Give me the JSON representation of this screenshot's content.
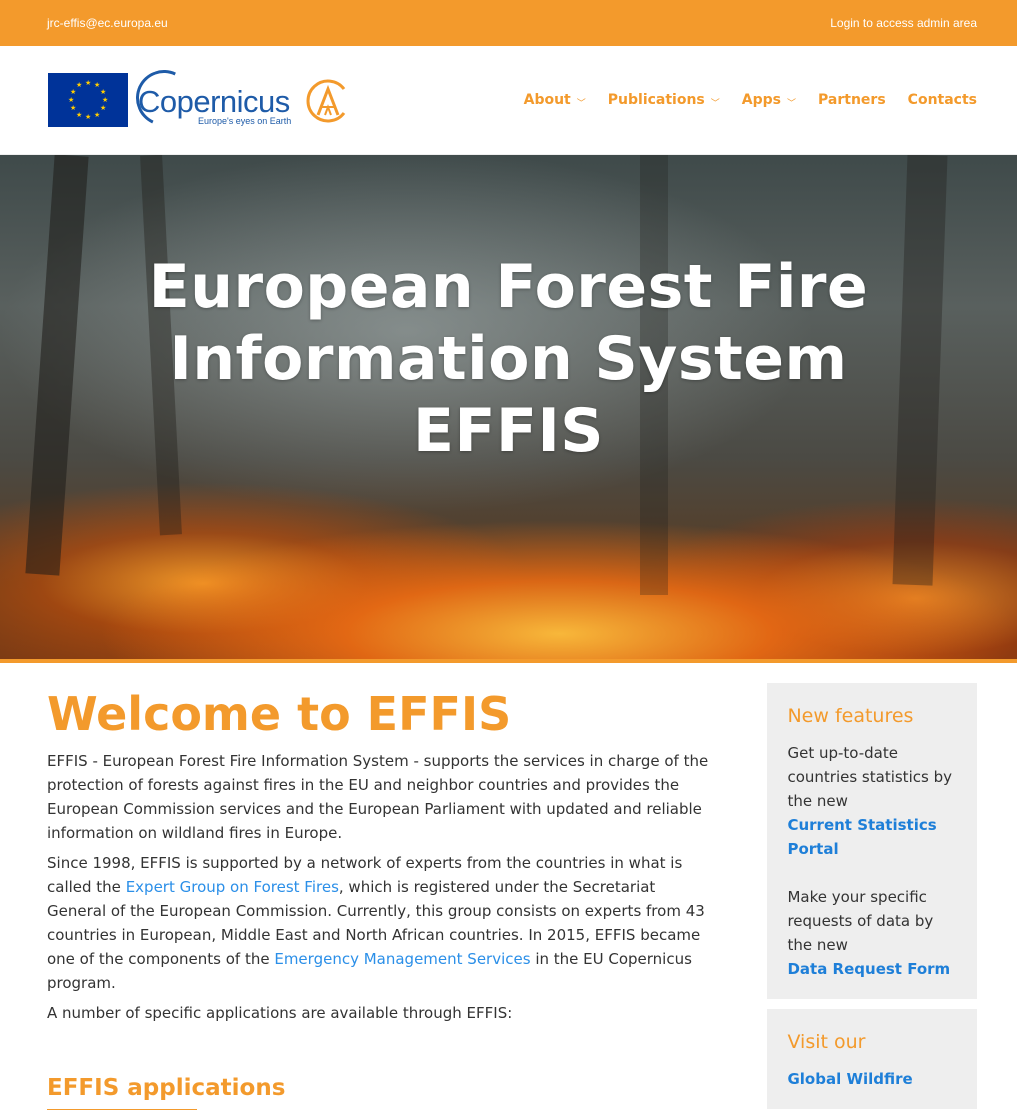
{
  "topbar": {
    "email": "jrc-effis@ec.europa.eu",
    "login": "Login to access admin area"
  },
  "header": {
    "logo_wordmark": "Copernicus",
    "logo_tagline": "Europe's eyes on Earth"
  },
  "nav": {
    "items": [
      {
        "label": "About",
        "has_dropdown": true
      },
      {
        "label": "Publications",
        "has_dropdown": true
      },
      {
        "label": "Apps",
        "has_dropdown": true
      },
      {
        "label": "Partners",
        "has_dropdown": false
      },
      {
        "label": "Contacts",
        "has_dropdown": false
      }
    ]
  },
  "hero": {
    "title_line1": "European Forest Fire",
    "title_line2": "Information System",
    "title_line3": "EFFIS"
  },
  "main": {
    "heading": "Welcome to EFFIS",
    "p1": "EFFIS - European Forest Fire Information System - supports the services in charge of the protection of forests against fires in the EU and neighbor countries and provides the European Commission services and the European Parliament with updated and reliable information on wildland fires in Europe.",
    "p2_a": "Since 1998, EFFIS is supported by a network of experts from the countries in what is called the ",
    "p2_link1": "Expert Group on Forest Fires",
    "p2_b": ", which is registered under the Secretariat General of the European Commission. Currently, this group consists on experts from 43 countries in European, Middle East and North African countries. In 2015, EFFIS became one of the components of the ",
    "p2_link2": "Emergency Management Services",
    "p2_c": " in the EU Copernicus program.",
    "p3": "A number of specific applications are available through EFFIS:",
    "apps_heading": "EFFIS applications"
  },
  "sidebar": {
    "box1": {
      "title": "New features",
      "text1": "Get up-to-date countries statistics by the new",
      "link1": "Current Statistics Portal",
      "text2": "Make your specific requests of data by the new",
      "link2": "Data Request Form"
    },
    "box2": {
      "title": "Visit our",
      "link1": "Global Wildfire"
    }
  },
  "colors": {
    "accent": "#f39a2c",
    "link": "#2b8fe8",
    "eu_blue": "#003399"
  }
}
